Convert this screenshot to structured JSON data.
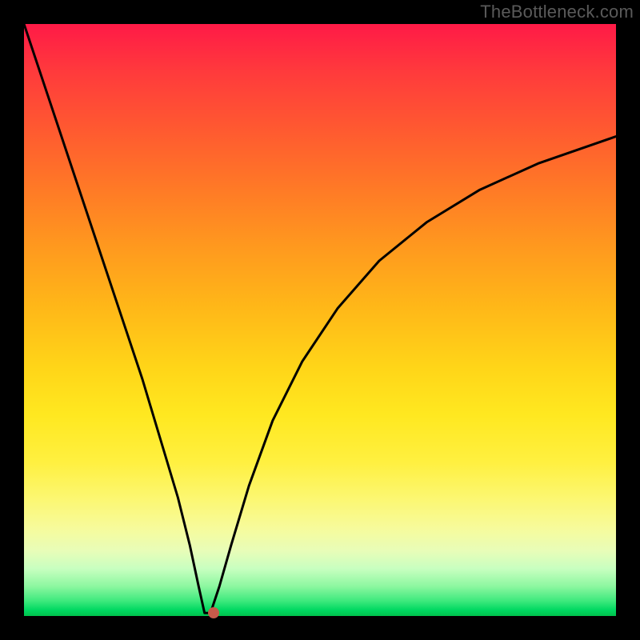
{
  "watermark": "TheBottleneck.com",
  "chart_data": {
    "type": "line",
    "title": "",
    "xlabel": "",
    "ylabel": "",
    "xlim": [
      0,
      100
    ],
    "ylim": [
      0,
      100
    ],
    "grid": false,
    "legend": false,
    "background_gradient": {
      "top_color": "#ff1a47",
      "mid_color": "#ffd518",
      "bottom_color": "#00c24d"
    },
    "series": [
      {
        "name": "bottleneck-curve",
        "color": "#000000",
        "x": [
          0.0,
          4.0,
          8.0,
          12.0,
          16.0,
          20.0,
          23.0,
          26.0,
          28.0,
          29.5,
          30.5,
          31.5,
          33.0,
          35.0,
          38.0,
          42.0,
          47.0,
          53.0,
          60.0,
          68.0,
          77.0,
          87.0,
          100.0
        ],
        "y": [
          100.0,
          88.0,
          76.0,
          64.0,
          52.0,
          40.0,
          30.0,
          20.0,
          12.0,
          5.0,
          0.5,
          0.5,
          5.0,
          12.0,
          22.0,
          33.0,
          43.0,
          52.0,
          60.0,
          66.5,
          72.0,
          76.5,
          81.0
        ]
      }
    ],
    "marker": {
      "name": "optimal-point",
      "x": 32.0,
      "y": 0.5,
      "color": "#c75a4a"
    }
  }
}
